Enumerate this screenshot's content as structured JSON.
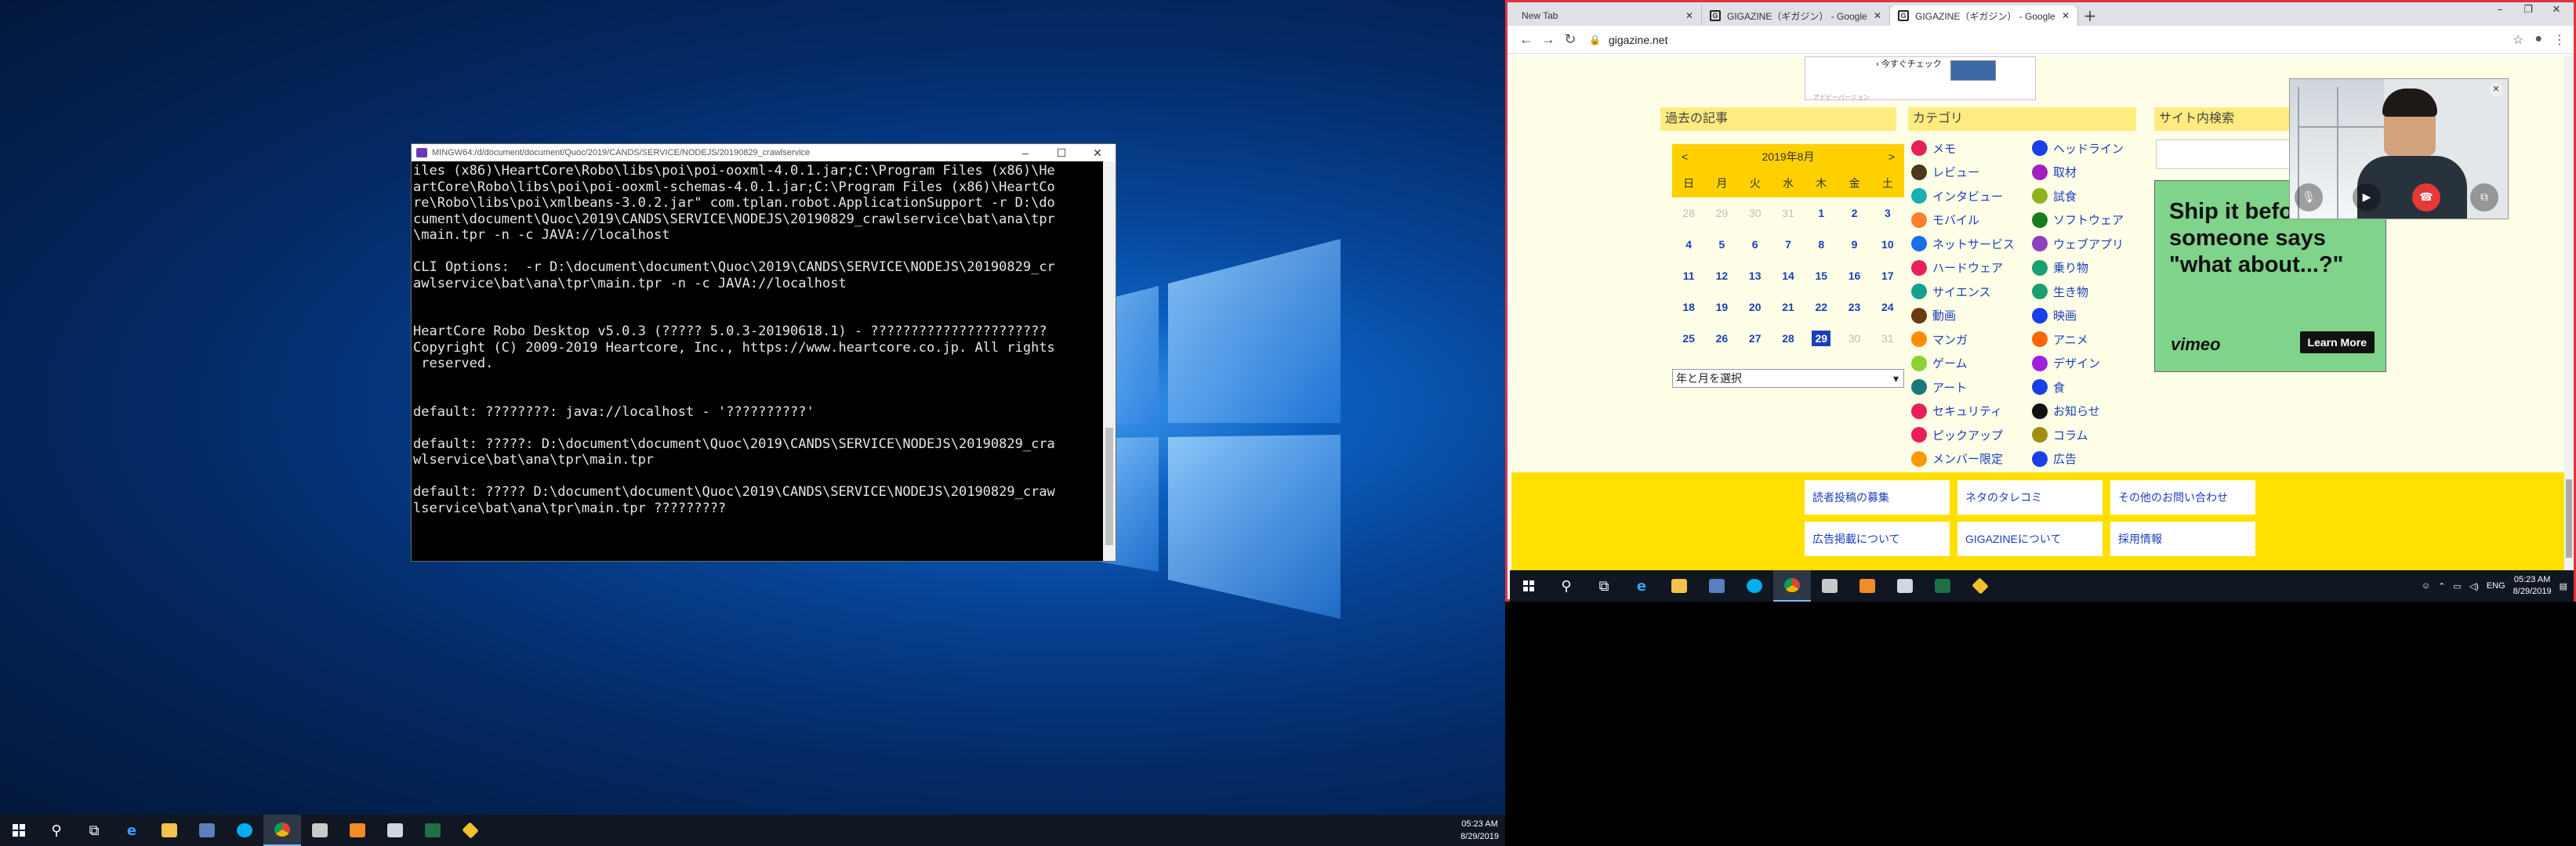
{
  "desktop_left": {
    "terminal": {
      "title": "MINGW64:/d/document/document/Quoc/2019/CANDS/SERVICE/NODEJS/20190829_crawlservice",
      "lines": [
        "iles (x86)\\HeartCore\\Robo\\libs\\poi\\poi-ooxml-4.0.1.jar;C:\\Program Files (x86)\\He",
        "artCore\\Robo\\libs\\poi\\poi-ooxml-schemas-4.0.1.jar;C:\\Program Files (x86)\\HeartCo",
        "re\\Robo\\libs\\poi\\xmlbeans-3.0.2.jar\" com.tplan.robot.ApplicationSupport -r D:\\do",
        "cument\\document\\Quoc\\2019\\CANDS\\SERVICE\\NODEJS\\20190829_crawlservice\\bat\\ana\\tpr",
        "\\main.tpr -n -c JAVA://localhost",
        "",
        "CLI Options:  -r D:\\document\\document\\Quoc\\2019\\CANDS\\SERVICE\\NODEJS\\20190829_cr",
        "awlservice\\bat\\ana\\tpr\\main.tpr -n -c JAVA://localhost",
        "",
        "",
        "HeartCore Robo Desktop v5.0.3 (????? 5.0.3-20190618.1) - ??????????????????????",
        "Copyright (C) 2009-2019 Heartcore, Inc., https://www.heartcore.co.jp. All rights",
        " reserved.",
        "",
        "",
        "default: ????????: java://localhost - '??????????'",
        "",
        "default: ?????: D:\\document\\document\\Quoc\\2019\\CANDS\\SERVICE\\NODEJS\\20190829_cra",
        "wlservice\\bat\\ana\\tpr\\main.tpr",
        "",
        "default: ????? D:\\document\\document\\Quoc\\2019\\CANDS\\SERVICE\\NODEJS\\20190829_craw",
        "lservice\\bat\\ana\\tpr\\main.tpr ?????????"
      ]
    },
    "taskbar": {
      "time": "05:23 AM",
      "date": "8/29/2019"
    }
  },
  "desktop_right": {
    "tabs": [
      {
        "label": "New Tab",
        "active": false
      },
      {
        "label": "GIGAZINE（ギガジン） - Google",
        "active": false
      },
      {
        "label": "GIGAZINE（ギガジン） - Google",
        "active": true
      }
    ],
    "url": "gigazine.net",
    "ad_top": {
      "check": "› 今すぐチェック",
      "small": "アドビーバージョン"
    },
    "past_articles": {
      "heading": "過去の記事",
      "month": "2019年8月",
      "prev": "<",
      "next": ">",
      "dows": [
        "日",
        "月",
        "火",
        "水",
        "木",
        "金",
        "土"
      ],
      "weeks": [
        [
          "28",
          "29",
          "30",
          "31",
          "1",
          "2",
          "3"
        ],
        [
          "4",
          "5",
          "6",
          "7",
          "8",
          "9",
          "10"
        ],
        [
          "11",
          "12",
          "13",
          "14",
          "15",
          "16",
          "17"
        ],
        [
          "18",
          "19",
          "20",
          "21",
          "22",
          "23",
          "24"
        ],
        [
          "25",
          "26",
          "27",
          "28",
          "29",
          "30",
          "31"
        ]
      ],
      "select": "年と月を選択"
    },
    "category": {
      "heading": "カテゴリ",
      "left": [
        {
          "label": "メモ",
          "color": "#e8205a"
        },
        {
          "label": "レビュー",
          "color": "#4a3a1a"
        },
        {
          "label": "インタビュー",
          "color": "#18b0b0"
        },
        {
          "label": "モバイル",
          "color": "#ff7f2a"
        },
        {
          "label": "ネットサービス",
          "color": "#1a6fe8"
        },
        {
          "label": "ハードウェア",
          "color": "#e8205a"
        },
        {
          "label": "サイエンス",
          "color": "#15a090"
        },
        {
          "label": "動画",
          "color": "#6b3a10"
        },
        {
          "label": "マンガ",
          "color": "#ff8c00"
        },
        {
          "label": "ゲーム",
          "color": "#8ed030"
        },
        {
          "label": "アート",
          "color": "#1a7a7a"
        },
        {
          "label": "セキュリティ",
          "color": "#e8205a"
        },
        {
          "label": "ピックアップ",
          "color": "#e8205a"
        },
        {
          "label": "メンバー限定",
          "color": "#ff9900"
        }
      ],
      "right": [
        {
          "label": "ヘッドライン",
          "color": "#1a3fe8"
        },
        {
          "label": "取材",
          "color": "#a020c0"
        },
        {
          "label": "試食",
          "color": "#90b020"
        },
        {
          "label": "ソフトウェア",
          "color": "#1a7a20"
        },
        {
          "label": "ウェブアプリ",
          "color": "#9040c0"
        },
        {
          "label": "乗り物",
          "color": "#18a070"
        },
        {
          "label": "生き物",
          "color": "#18a070"
        },
        {
          "label": "映画",
          "color": "#1a3fe8"
        },
        {
          "label": "アニメ",
          "color": "#ff6600"
        },
        {
          "label": "デザイン",
          "color": "#a020e0"
        },
        {
          "label": "食",
          "color": "#1a3fe8"
        },
        {
          "label": "お知らせ",
          "color": "#111111"
        },
        {
          "label": "コラム",
          "color": "#a09010"
        },
        {
          "label": "広告",
          "color": "#1a3fe8"
        }
      ]
    },
    "site_search": {
      "heading": "サイト内検索"
    },
    "vimeo_ad": {
      "headline": "Ship it before someone says \"what about...?\"",
      "brand": "vimeo",
      "cta": "Learn More"
    },
    "footer_links": [
      "読者投稿の募集",
      "ネタのタレコミ",
      "その他のお問い合わせ",
      "広告掲載について",
      "GIGAZINEについて",
      "採用情報"
    ],
    "taskbar": {
      "lang": "ENG",
      "time": "05:23 AM",
      "date": "8/29/2019"
    }
  }
}
